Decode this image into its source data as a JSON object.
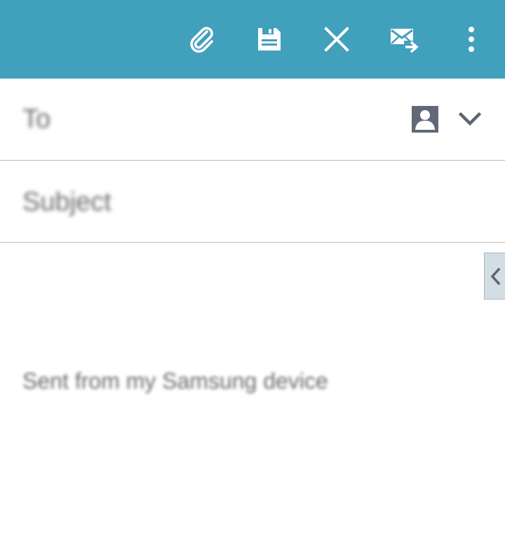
{
  "toolbar": {
    "background": "#41a0bc",
    "icons": {
      "attach": "paperclip-icon",
      "save": "save-icon",
      "discard": "close-icon",
      "send": "send-mail-icon",
      "more": "more-vert-icon"
    }
  },
  "recipient": {
    "placeholder": "To",
    "contact_icon": "contact-picker-icon",
    "expand_icon": "chevron-down-icon"
  },
  "subject": {
    "placeholder": "Subject"
  },
  "body": {
    "signature": "Sent from my Samsung device"
  },
  "side_panel": {
    "icon": "chevron-left-icon"
  }
}
